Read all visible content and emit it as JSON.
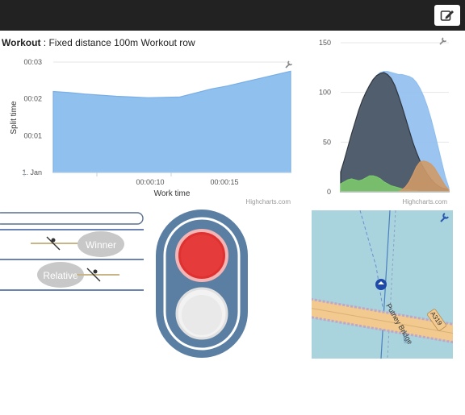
{
  "header": {
    "edit_icon": "edit-pencil-icon"
  },
  "workout": {
    "title_bold": "Workout",
    "title_rest": " : Fixed distance 100m Workout row"
  },
  "chart_data": [
    {
      "type": "area",
      "title": "",
      "xlabel": "Work time",
      "ylabel": "Split time",
      "y_ticks": [
        "1. Jan",
        "00:01",
        "00:02",
        "00:03"
      ],
      "x_ticks": [
        "00:00:10",
        "00:00:15"
      ],
      "credits": "Highcharts.com",
      "x": [
        0,
        2,
        4,
        6,
        8,
        10,
        12,
        14,
        16,
        18,
        20,
        22,
        24,
        26,
        28,
        30
      ],
      "series": [
        {
          "values": [
            2.2,
            2.17,
            2.13,
            2.1,
            2.07,
            2.05,
            2.03,
            2.04,
            2.05,
            2.16,
            2.27,
            2.35,
            2.45,
            2.55,
            2.65,
            2.75
          ]
        }
      ],
      "ylim": [
        0,
        3
      ],
      "color": "#90c0ee"
    },
    {
      "type": "area",
      "y_ticks": [
        "0",
        "50",
        "100",
        "150"
      ],
      "credits": "Highcharts.com",
      "ylim": [
        0,
        150
      ],
      "x": [
        0,
        1,
        2,
        3,
        4,
        5,
        6,
        7,
        8,
        9,
        10,
        11,
        12,
        13,
        14,
        15,
        16,
        17,
        18,
        19,
        20,
        21,
        22,
        23,
        24,
        25,
        26,
        27,
        28,
        29,
        30
      ],
      "series": [
        {
          "color": "#90bfee",
          "values": [
            20,
            28,
            38,
            50,
            62,
            74,
            85,
            96,
            105,
            112,
            117,
            120,
            121,
            121,
            120,
            119,
            118,
            118,
            117,
            116,
            114,
            110,
            104,
            96,
            86,
            74,
            60,
            45,
            30,
            15,
            4
          ]
        },
        {
          "color": "#4d5866",
          "values": [
            20,
            32,
            45,
            58,
            70,
            82,
            92,
            100,
            107,
            113,
            117,
            119,
            120,
            118,
            114,
            107,
            97,
            86,
            74,
            62,
            50,
            40,
            31,
            24,
            18,
            13,
            9,
            6,
            4,
            3,
            2
          ]
        },
        {
          "color": "#7bc86c",
          "values": [
            8,
            10,
            12,
            13,
            12,
            11,
            12,
            14,
            16,
            16,
            15,
            13,
            10,
            8,
            6,
            5,
            4,
            3,
            2,
            2,
            1,
            1,
            0,
            0,
            0,
            0,
            0,
            0,
            0,
            0,
            0
          ]
        },
        {
          "color": "#d09a68",
          "values": [
            0,
            0,
            0,
            0,
            0,
            0,
            0,
            0,
            0,
            0,
            0,
            0,
            0,
            0,
            0,
            0,
            0,
            2,
            5,
            10,
            17,
            25,
            30,
            31,
            30,
            28,
            24,
            18,
            12,
            6,
            2
          ]
        }
      ]
    }
  ],
  "race": {
    "winner_label": "Winner",
    "relative_label": "Relative"
  },
  "map": {
    "road_label": "A319",
    "street_label": "Putney Bridge",
    "river_label": "River",
    "tool_icon": "wrench-icon"
  }
}
